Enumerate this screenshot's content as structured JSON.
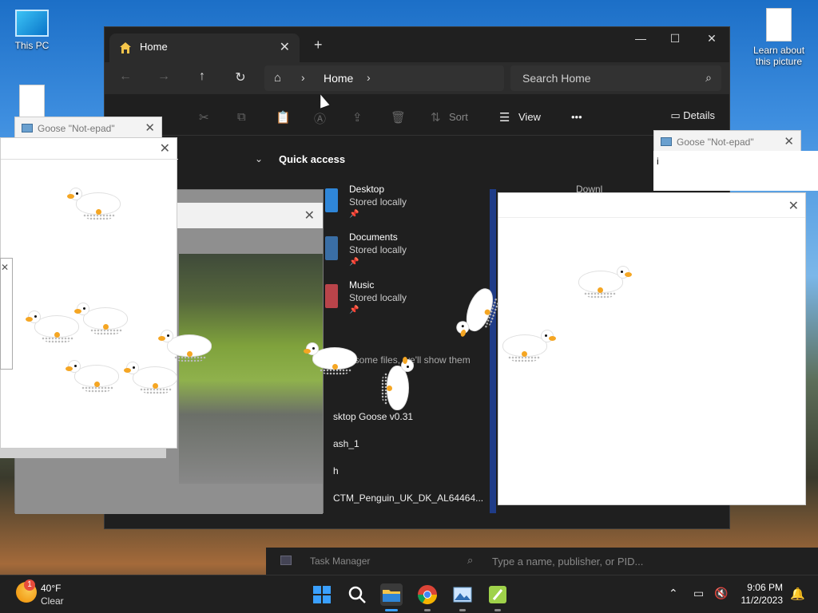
{
  "desktop": {
    "this_pc": "This PC",
    "learn": "Learn about this picture"
  },
  "explorer": {
    "tab_title": "Home",
    "new_tab": "+",
    "minimize": "—",
    "maximize": "☐",
    "close": "✕",
    "address_crumb": "Home",
    "search_placeholder": "Search Home",
    "sort_label": "Sort",
    "view_label": "View",
    "more_label": "•••",
    "details_label": "Details",
    "quick_access": "Quick access",
    "downloads_fragment": "Downl",
    "items": [
      {
        "name": "Desktop",
        "sub": "Stored locally"
      },
      {
        "name": "Documents",
        "sub": "Stored locally"
      },
      {
        "name": "Music",
        "sub": "Stored locally"
      }
    ],
    "recent_msg": "ited some files, we'll show them",
    "recent": [
      "sktop Goose v0.31",
      "ash_1",
      "h",
      "CTM_Penguin_UK_DK_AL64464..."
    ]
  },
  "notepads": {
    "left_title": "Goose \"Not-epad\"",
    "right_title": "Goose \"Not-epad\"",
    "right_fragment": "i"
  },
  "taskmanager": {
    "title": "Task Manager",
    "search_placeholder": "Type a name, publisher, or PID..."
  },
  "taskbar": {
    "weather_badge": "1",
    "temp": "40°F",
    "condition": "Clear",
    "time": "9:06 PM",
    "date": "11/2/2023"
  }
}
